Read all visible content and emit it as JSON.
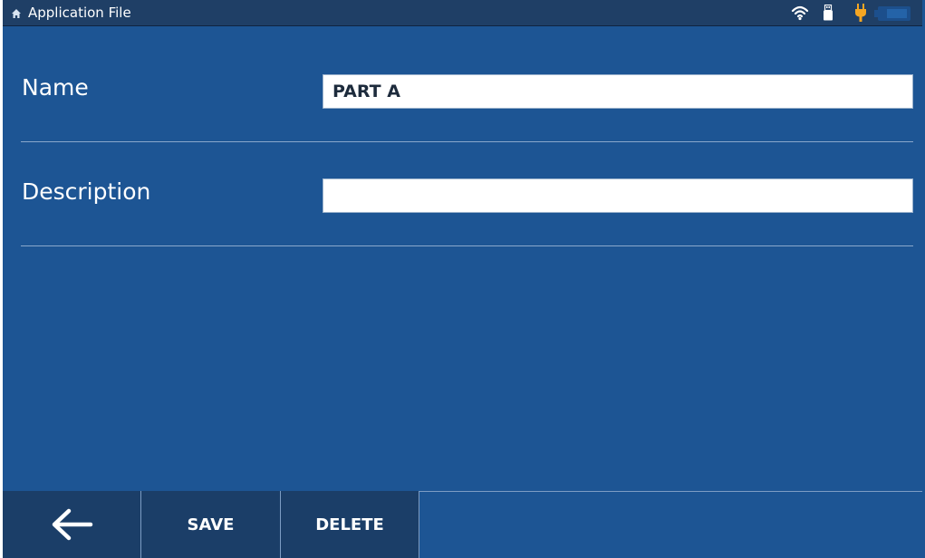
{
  "status_bar": {
    "title": "Application File",
    "icons": [
      "home-icon",
      "wifi-icon",
      "usb-icon",
      "plug-icon",
      "battery-icon"
    ]
  },
  "form": {
    "name_label": "Name",
    "name_value": "PART A",
    "description_label": "Description",
    "description_value": ""
  },
  "toolbar": {
    "back_icon": "arrow-left-icon",
    "save_label": "SAVE",
    "delete_label": "DELETE"
  },
  "colors": {
    "background": "#1d5594",
    "status_bar": "#1f3f66",
    "toolbar_button": "#1b3e68",
    "plug_accent": "#f5a623"
  }
}
